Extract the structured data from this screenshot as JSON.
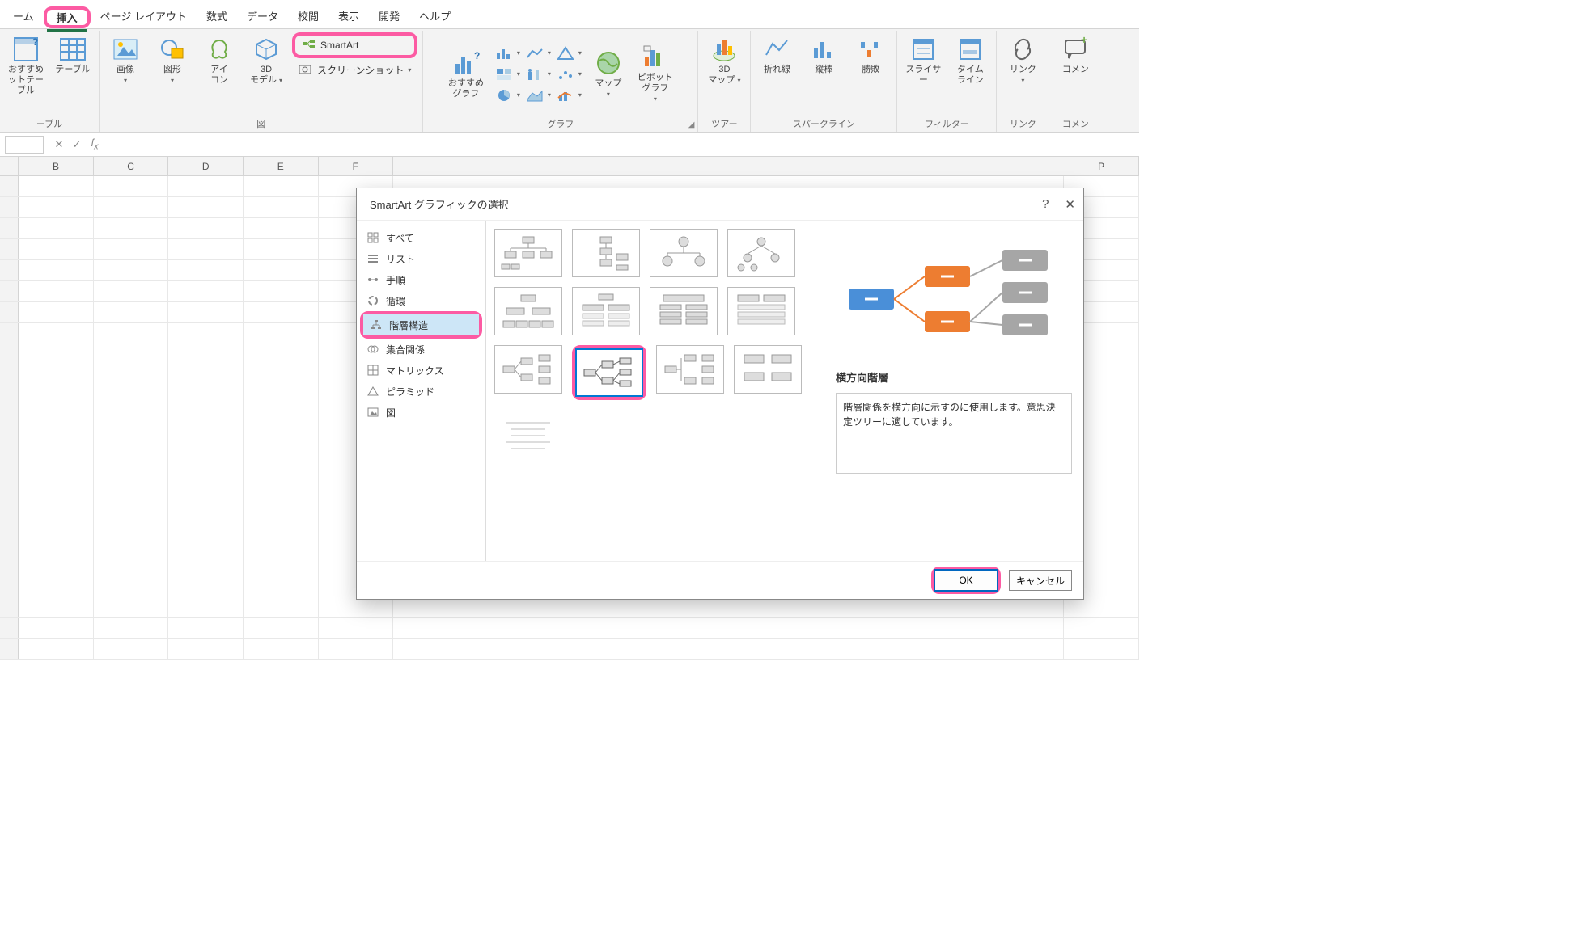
{
  "tabs": {
    "home": "ーム",
    "insert": "挿入",
    "pageLayout": "ページ レイアウト",
    "formulas": "数式",
    "data": "データ",
    "review": "校閲",
    "view": "表示",
    "developer": "開発",
    "help": "ヘルプ"
  },
  "ribbon": {
    "groups": {
      "tables": "ーブル",
      "illustrations": "図",
      "charts": "グラフ",
      "tours": "ツアー",
      "sparklines": "スパークライン",
      "filters": "フィルター",
      "links": "リンク",
      "comments": "コメン"
    },
    "buttons": {
      "pivotRec": "おすすめ\nットテーブル",
      "table": "テーブル",
      "pictures": "画像",
      "shapes": "図形",
      "icons": "アイ\nコン",
      "models3d": "3D\nモデル",
      "smartart": "SmartArt",
      "screenshot": "スクリーンショット",
      "recCharts": "おすすめ\nグラフ",
      "maps": "マップ",
      "pivotChart": "ピボットグラフ",
      "map3d": "3D\nマップ",
      "line": "折れ線",
      "column": "縦棒",
      "winloss": "勝敗",
      "slicer": "スライサー",
      "timeline": "タイム\nライン",
      "link": "リンク",
      "comment": "コメン"
    }
  },
  "columns": [
    "B",
    "C",
    "D",
    "E",
    "F",
    "P"
  ],
  "dialog": {
    "title": "SmartArt グラフィックの選択",
    "help": "?",
    "categories": {
      "all": "すべて",
      "list": "リスト",
      "process": "手順",
      "cycle": "循環",
      "hierarchy": "階層構造",
      "relationship": "集合関係",
      "matrix": "マトリックス",
      "pyramid": "ピラミッド",
      "picture": "図"
    },
    "preview": {
      "title": "横方向階層",
      "desc": "階層関係を横方向に示すのに使用します。意思決定ツリーに適しています。"
    },
    "ok": "OK",
    "cancel": "キャンセル"
  }
}
